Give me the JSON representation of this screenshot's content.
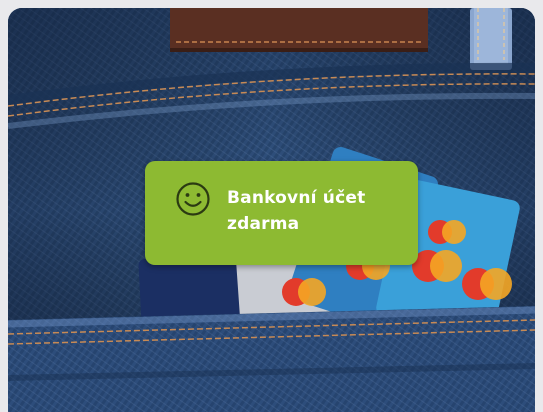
{
  "promo": {
    "badge_text": "Bankovní účet zdarma",
    "badge_icon": "smiley-icon",
    "badge_color": "#8dba32"
  },
  "card_brands": [
    "Master Card"
  ]
}
